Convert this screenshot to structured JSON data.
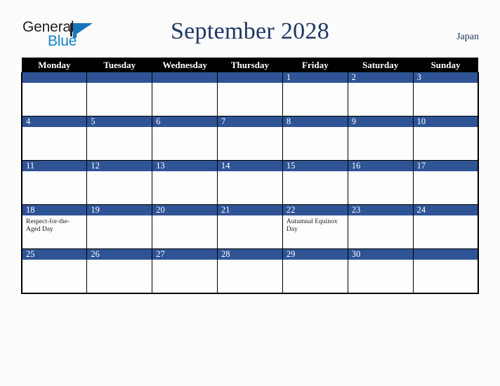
{
  "brand": {
    "name_part1": "General",
    "name_part2": "Blue",
    "triangle_color": "#1875bc",
    "text_color": "#231f20"
  },
  "header": {
    "title": "September 2028",
    "region": "Japan",
    "title_color": "#1f3864"
  },
  "theme": {
    "header_row_bg": "#000000",
    "header_row_text": "#ffffff",
    "date_bar_bg": "#2f5496",
    "date_bar_text": "#ffffff",
    "cell_bg": "#fdfdfd",
    "page_bg": "#fcfcfc",
    "grid_line": "#000000"
  },
  "weekday_headers": [
    "Monday",
    "Tuesday",
    "Wednesday",
    "Thursday",
    "Friday",
    "Saturday",
    "Sunday"
  ],
  "weeks": [
    [
      {
        "day": "",
        "event": ""
      },
      {
        "day": "",
        "event": ""
      },
      {
        "day": "",
        "event": ""
      },
      {
        "day": "",
        "event": ""
      },
      {
        "day": "1",
        "event": ""
      },
      {
        "day": "2",
        "event": ""
      },
      {
        "day": "3",
        "event": ""
      }
    ],
    [
      {
        "day": "4",
        "event": ""
      },
      {
        "day": "5",
        "event": ""
      },
      {
        "day": "6",
        "event": ""
      },
      {
        "day": "7",
        "event": ""
      },
      {
        "day": "8",
        "event": ""
      },
      {
        "day": "9",
        "event": ""
      },
      {
        "day": "10",
        "event": ""
      }
    ],
    [
      {
        "day": "11",
        "event": ""
      },
      {
        "day": "12",
        "event": ""
      },
      {
        "day": "13",
        "event": ""
      },
      {
        "day": "14",
        "event": ""
      },
      {
        "day": "15",
        "event": ""
      },
      {
        "day": "16",
        "event": ""
      },
      {
        "day": "17",
        "event": ""
      }
    ],
    [
      {
        "day": "18",
        "event": "Respect-for-the-Aged Day"
      },
      {
        "day": "19",
        "event": ""
      },
      {
        "day": "20",
        "event": ""
      },
      {
        "day": "21",
        "event": ""
      },
      {
        "day": "22",
        "event": "Autumnal Equinox Day"
      },
      {
        "day": "23",
        "event": ""
      },
      {
        "day": "24",
        "event": ""
      }
    ],
    [
      {
        "day": "25",
        "event": ""
      },
      {
        "day": "26",
        "event": ""
      },
      {
        "day": "27",
        "event": ""
      },
      {
        "day": "28",
        "event": ""
      },
      {
        "day": "29",
        "event": ""
      },
      {
        "day": "30",
        "event": ""
      },
      {
        "day": "",
        "event": ""
      }
    ]
  ]
}
